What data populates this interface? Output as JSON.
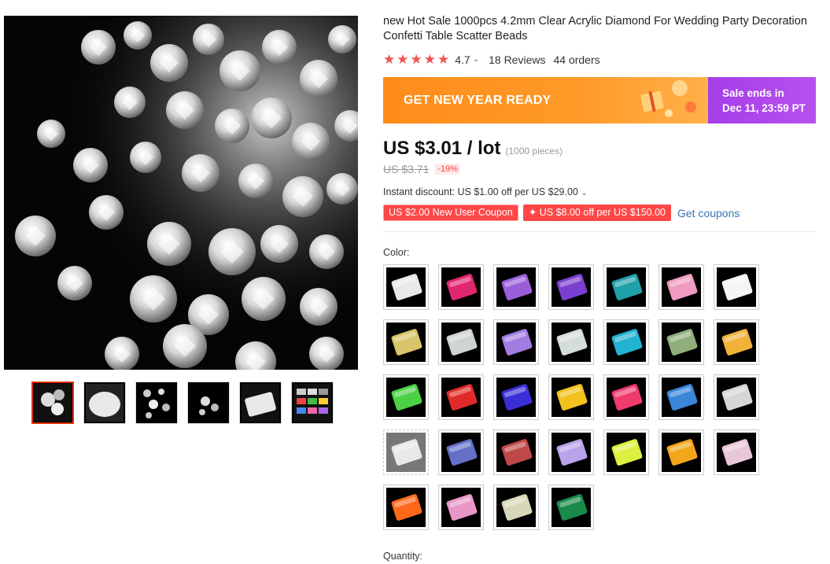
{
  "product": {
    "title": "new Hot Sale 1000pcs 4.2mm Clear Acrylic Diamond For Wedding Party Decoration Confetti Table Scatter Beads",
    "rating": "4.7",
    "reviews": "18 Reviews",
    "orders": "44 orders",
    "star_count": 5
  },
  "banner": {
    "promo_text": "GET NEW YEAR READY",
    "sale_line1": "Sale ends in",
    "sale_line2": "Dec 11, 23:59 PT"
  },
  "pricing": {
    "price": "US $3.01 / lot",
    "pieces": "(1000 pieces)",
    "original_price": "US $3.71",
    "discount": "-19%",
    "instant_discount": "Instant discount: US $1.00 off per US $29.00"
  },
  "coupons": {
    "new_user": "US $2.00 New User Coupon",
    "store": "✦ US $8.00 off per US $150.00",
    "get_coupons": "Get coupons"
  },
  "variants": {
    "color_label": "Color:",
    "quantity_label": "Quantity:",
    "swatches": [
      {
        "color": "#e8e8e8",
        "disabled": false
      },
      {
        "color": "#e0266e",
        "disabled": false
      },
      {
        "color": "#9b5ed8",
        "disabled": false
      },
      {
        "color": "#7a3ed0",
        "disabled": false
      },
      {
        "color": "#1fa0a8",
        "disabled": false
      },
      {
        "color": "#f09ac0",
        "disabled": false
      },
      {
        "color": "#f4f4f4",
        "disabled": false
      },
      {
        "color": "#d8c46a",
        "disabled": false
      },
      {
        "color": "#cfd3d4",
        "disabled": false
      },
      {
        "color": "#a27ce0",
        "disabled": false
      },
      {
        "color": "#d5dcdc",
        "disabled": false
      },
      {
        "color": "#22b2d2",
        "disabled": false
      },
      {
        "color": "#8fae7a",
        "disabled": false
      },
      {
        "color": "#f2b23a",
        "disabled": false
      },
      {
        "color": "#4cd146",
        "disabled": false
      },
      {
        "color": "#e02a2a",
        "disabled": false
      },
      {
        "color": "#3a2ed8",
        "disabled": false
      },
      {
        "color": "#f2c21e",
        "disabled": false
      },
      {
        "color": "#ef3a6c",
        "disabled": false
      },
      {
        "color": "#3a86d8",
        "disabled": false
      },
      {
        "color": "#d6d6d6",
        "disabled": false
      },
      {
        "color": "#e8e8e8",
        "disabled": true
      },
      {
        "color": "#6470c8",
        "disabled": false
      },
      {
        "color": "#c04848",
        "disabled": false
      },
      {
        "color": "#b8a2ea",
        "disabled": false
      },
      {
        "color": "#dcf040",
        "disabled": false
      },
      {
        "color": "#f2a61a",
        "disabled": false
      },
      {
        "color": "#e8c8d8",
        "disabled": false
      },
      {
        "color": "#ff6a1a",
        "disabled": false
      },
      {
        "color": "#e896c8",
        "disabled": false
      },
      {
        "color": "#d8d8b8",
        "disabled": false
      },
      {
        "color": "#1a8a4a",
        "disabled": false
      }
    ]
  },
  "gallery": {
    "thumbnail_count": 6,
    "accent": "#e62e04"
  }
}
